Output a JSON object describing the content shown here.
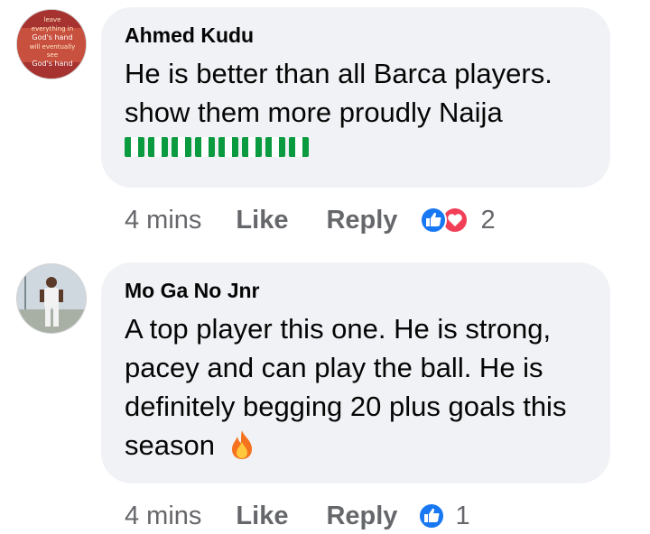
{
  "comments": [
    {
      "author": "Ahmed Kudu",
      "avatar_text": [
        "leave",
        "everything in",
        "God's hand",
        "will eventually",
        "see",
        "God's hand"
      ],
      "text_line1": "He is better than all Barca players.",
      "text_line2": "show them more proudly Naija",
      "emoji": "nigeria-flag x8",
      "time": "4 mins",
      "like_label": "Like",
      "reply_label": "Reply",
      "reaction_count": "2",
      "reactions": [
        "like-icon",
        "love-icon"
      ]
    },
    {
      "author": "Mo Ga No Jnr",
      "text_line1": "A top player this one. He is strong,",
      "text_line2": "pacey and can play the ball. He is",
      "text_line3": "definitely begging 20 plus goals this",
      "text_line4": "season",
      "emoji": "fire-icon",
      "time": "4 mins",
      "like_label": "Like",
      "reply_label": "Reply",
      "reaction_count": "1",
      "reactions": [
        "like-icon"
      ]
    }
  ],
  "colors": {
    "bubble": "#f0f2f5",
    "meta_text": "#65676b",
    "like_blue": "#1877f2",
    "love_red": "#f33e58"
  }
}
